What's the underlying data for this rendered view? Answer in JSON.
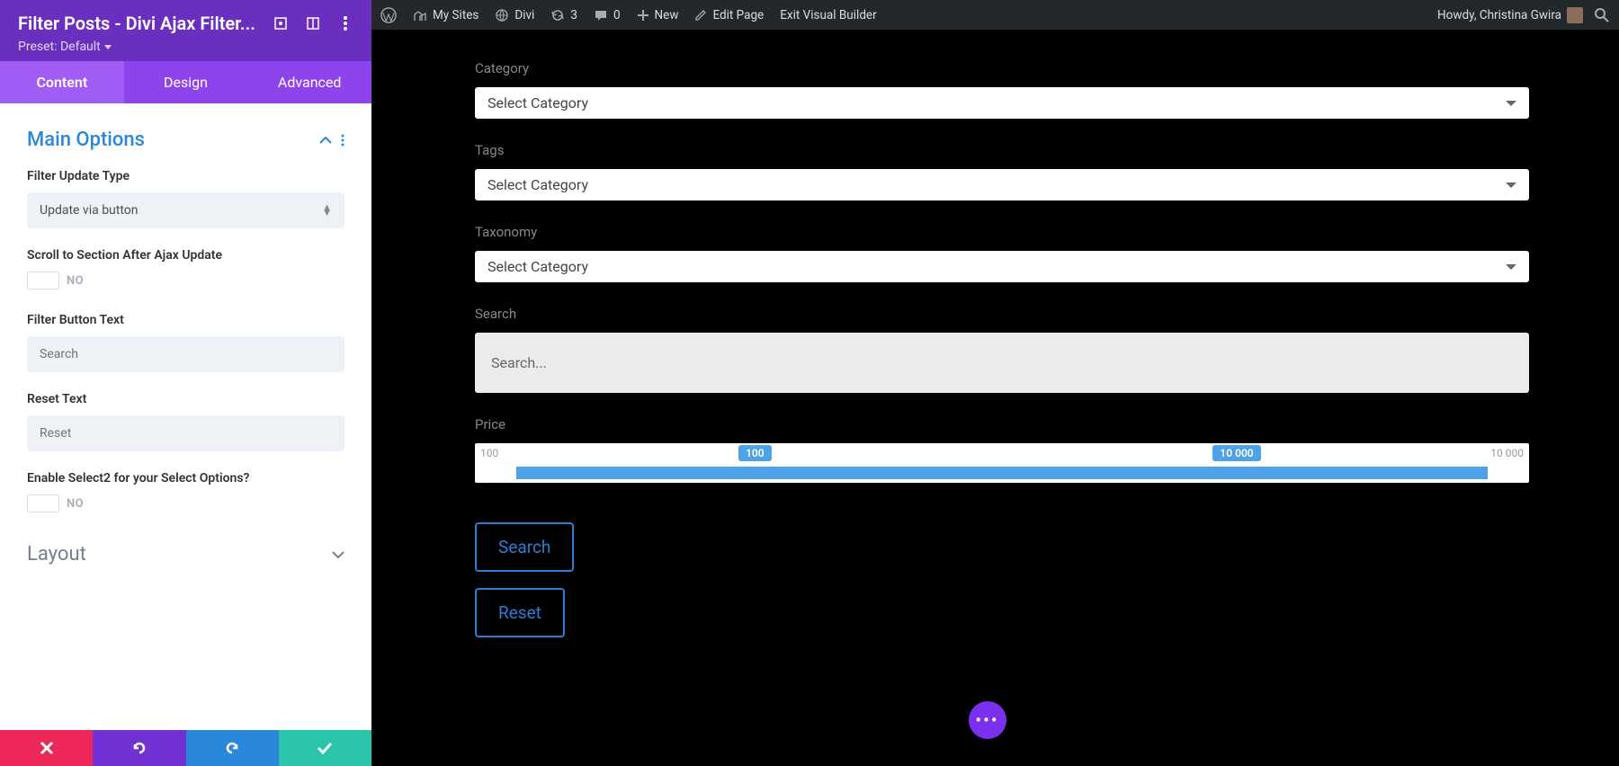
{
  "panel": {
    "title": "Filter Posts - Divi Ajax Filter...",
    "preset": "Preset: Default",
    "tabs": [
      "Content",
      "Design",
      "Advanced"
    ],
    "section_main": "Main Options",
    "filter_update_type_label": "Filter Update Type",
    "filter_update_type_value": "Update via button",
    "scroll_label": "Scroll to Section After Ajax Update",
    "scroll_value": "NO",
    "filter_btn_label": "Filter Button Text",
    "filter_btn_placeholder": "Search",
    "reset_label": "Reset Text",
    "reset_placeholder": "Reset",
    "select2_label": "Enable Select2 for your Select Options?",
    "select2_value": "NO",
    "layout": "Layout"
  },
  "wpbar": {
    "mysites": "My Sites",
    "divi": "Divi",
    "updates": "3",
    "comments": "0",
    "new": "New",
    "editpage": "Edit Page",
    "exitvb": "Exit Visual Builder",
    "howdy": "Howdy, Christina Gwira"
  },
  "preview": {
    "category_label": "Category",
    "category_value": "Select Category",
    "tags_label": "Tags",
    "tags_value": "Select Category",
    "taxonomy_label": "Taxonomy",
    "taxonomy_value": "Select Category",
    "search_label": "Search",
    "search_placeholder": "Search...",
    "price_label": "Price",
    "price_min": "100",
    "price_max": "10 000",
    "price_badge_low": "100",
    "price_badge_high": "10 000",
    "search_btn": "Search",
    "reset_btn": "Reset"
  }
}
